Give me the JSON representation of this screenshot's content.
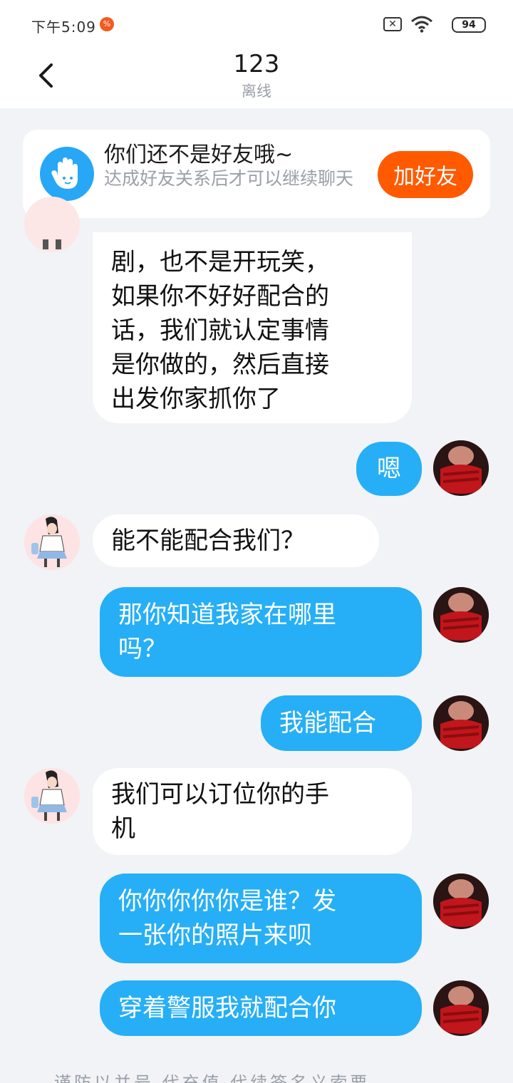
{
  "status_bar": {
    "time": "下午5:09",
    "battery": "94",
    "notification_icon": "red-circle-icon",
    "sim_icon": "no-sim-icon",
    "wifi_icon": "wifi-icon"
  },
  "header": {
    "title": "123",
    "subtitle": "离线",
    "back_icon": "chevron-left-icon"
  },
  "banner": {
    "icon": "hand-icon",
    "title": "你们还不是好友哦~",
    "description": "达成好友关系后才可以继续聊天",
    "button_label": "加好友"
  },
  "messages": [
    {
      "from": "them",
      "text": "剧，也不是开玩笑，\n如果你不好好配合的\n话，我们就认定事情\n是你做的，然后直接\n出发你家抓你了"
    },
    {
      "from": "me",
      "text": "嗯"
    },
    {
      "from": "them",
      "text": "能不能配合我们？"
    },
    {
      "from": "me",
      "text": "那你知道我家在哪里\n吗？"
    },
    {
      "from": "me",
      "text": "我能配合"
    },
    {
      "from": "them",
      "text": "我们可以订位你的手\n机"
    },
    {
      "from": "me",
      "text": "你你你你你是谁？发\n一张你的照片来呗"
    },
    {
      "from": "me",
      "text": "穿着警服我就配合你"
    }
  ],
  "bottom_partial_text": "谨防以并号 代充值 代续签名义索要",
  "colors": {
    "accent_blue": "#26aff6",
    "button_orange": "#ff5a00",
    "background": "#f1f3f6"
  }
}
